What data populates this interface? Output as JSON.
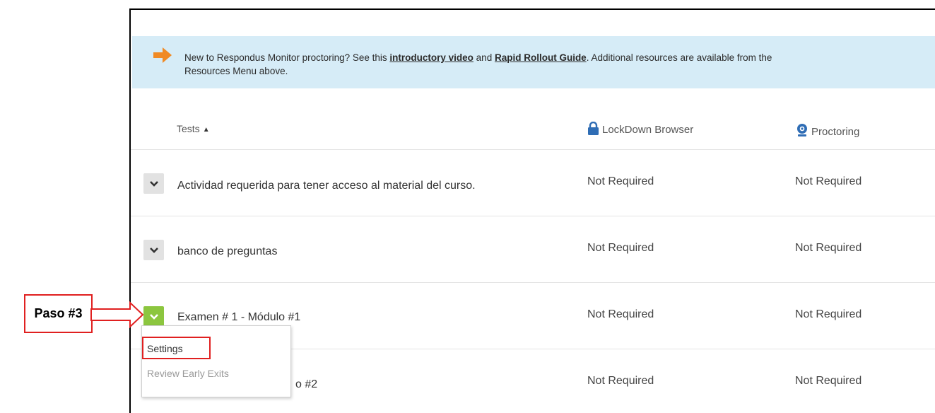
{
  "banner": {
    "text_1": "New to Respondus Monitor proctoring? See this ",
    "link_video": "introductory video",
    "text_2": " and ",
    "link_guide": "Rapid Rollout Guide",
    "text_3": ". Additional resources are available from the",
    "text_4": "Resources Menu above.",
    "arrow_color": "#f08a24"
  },
  "table": {
    "header": {
      "tests": "Tests",
      "lockdown": "LockDown Browser",
      "proctoring": "Proctoring"
    },
    "rows": [
      {
        "title": "Actividad requerida para tener acceso al material del curso.",
        "lockdown": "Not Required",
        "proctoring": "Not Required"
      },
      {
        "title": "banco de preguntas",
        "lockdown": "Not Required",
        "proctoring": "Not Required"
      },
      {
        "title": "Examen # 1 - Módulo #1",
        "lockdown": "Not Required",
        "proctoring": "Not Required"
      },
      {
        "title": "o #2",
        "lockdown": "Not Required",
        "proctoring": "Not Required"
      }
    ]
  },
  "dropdown": {
    "items": [
      "Settings",
      "Review Early Exits"
    ]
  },
  "annotation": {
    "label": "Paso #3",
    "color": "#e02020"
  },
  "colors": {
    "banner_bg": "#d6ecf7",
    "active_chevron": "#8cc63f",
    "icon_blue": "#2f6db5"
  }
}
